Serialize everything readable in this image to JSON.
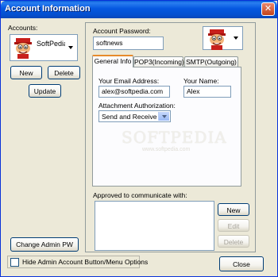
{
  "window": {
    "title": "Account Information",
    "close_glyph": "✕"
  },
  "accounts": {
    "label": "Accounts:",
    "selected": "SoftPedia",
    "new_label": "New",
    "delete_label": "Delete",
    "update_label": "Update"
  },
  "password": {
    "label": "Account Password:",
    "value": "softnews"
  },
  "tabs": [
    {
      "label": "General Info",
      "active": true
    },
    {
      "label": "POP3(Incoming)",
      "active": false
    },
    {
      "label": "SMTP(Outgoing)",
      "active": false
    }
  ],
  "general": {
    "email_label": "Your Email Address:",
    "email_value": "alex@softpedia.com",
    "name_label": "Your Name:",
    "name_value": "Alex",
    "attach_label": "Attachment Authorization:",
    "attach_value": "Send and Receive"
  },
  "watermark": {
    "text": "SOFTPEDIA",
    "url": "www.softpedia.com"
  },
  "approved": {
    "label": "Approved to communicate with:",
    "new_label": "New",
    "edit_label": "Edit",
    "delete_label": "Delete"
  },
  "footer": {
    "change_admin_label": "Change Admin PW",
    "hide_admin_label": "Hide Admin Account Button/Menu Options",
    "close_label": "Close"
  },
  "icons": {
    "avatar": "cartoon-face-icon"
  }
}
